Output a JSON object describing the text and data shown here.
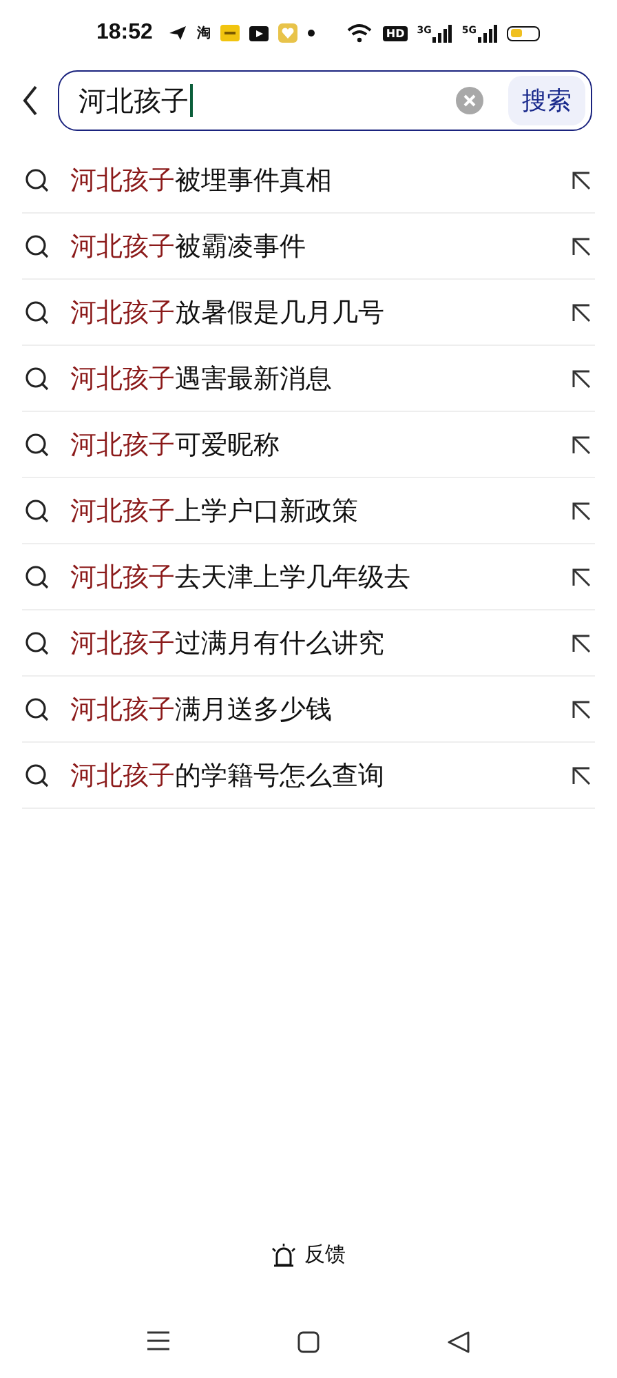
{
  "status_bar": {
    "time": "18:52",
    "app_icons": [
      {
        "kind": "send"
      },
      {
        "kind": "text",
        "label": "淘"
      },
      {
        "kind": "yellow"
      },
      {
        "kind": "play"
      },
      {
        "kind": "heart"
      },
      {
        "kind": "dot"
      }
    ],
    "hd_label": "HD",
    "signals": [
      {
        "label": "3G"
      },
      {
        "label": "5G"
      }
    ]
  },
  "search": {
    "value": "河北孩子",
    "button": "搜索"
  },
  "suggestions": [
    {
      "match": "河北孩子",
      "rest": "被埋事件真相"
    },
    {
      "match": "河北孩子",
      "rest": "被霸凌事件"
    },
    {
      "match": "河北孩子",
      "rest": "放暑假是几月几号"
    },
    {
      "match": "河北孩子",
      "rest": "遇害最新消息"
    },
    {
      "match": "河北孩子",
      "rest": "可爱昵称"
    },
    {
      "match": "河北孩子",
      "rest": "上学户口新政策"
    },
    {
      "match": "河北孩子",
      "rest": "去天津上学几年级去"
    },
    {
      "match": "河北孩子",
      "rest": "过满月有什么讲究"
    },
    {
      "match": "河北孩子",
      "rest": "满月送多少钱"
    },
    {
      "match": "河北孩子",
      "rest": "的学籍号怎么查询"
    }
  ],
  "feedback": "反馈"
}
